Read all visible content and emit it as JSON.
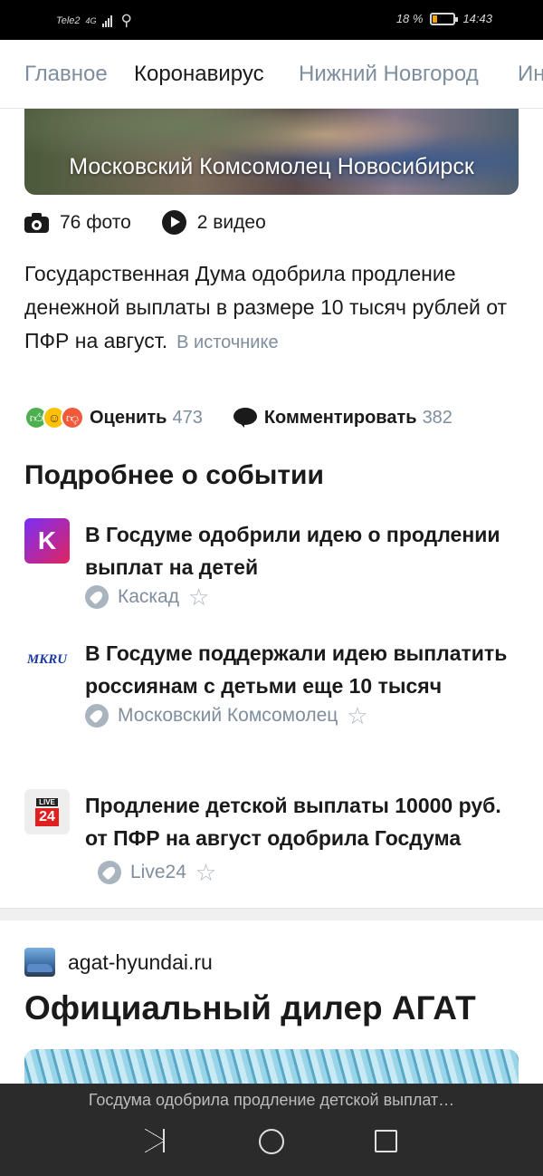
{
  "status_bar": {
    "carrier": "Tele2",
    "network": "4G",
    "battery_percent": "18 %",
    "battery_level": 0.18,
    "time": "14:43"
  },
  "tabs": [
    {
      "label": "Главное",
      "active": false
    },
    {
      "label": "Коронавирус",
      "active": true
    },
    {
      "label": "Нижний Новгород",
      "active": false
    },
    {
      "label": "Ин",
      "active": false
    }
  ],
  "hero": {
    "source": "Московский Комсомолец Новосибирск"
  },
  "media": {
    "photos": "76 фото",
    "videos": "2 видео"
  },
  "description": {
    "text": "Государственная Дума одобрила продление денежной выплаты в размере 10 тысяч рублей от ПФР на август.",
    "source_link": "В источнике"
  },
  "actions": {
    "rate_label": "Оценить",
    "rate_count": "473",
    "comment_label": "Комментировать",
    "comment_count": "382"
  },
  "more": {
    "title": "Подробнее о событии",
    "items": [
      {
        "title": "В Госдуме одобрили идею о продлении выплат на детей",
        "source": "Каскад",
        "logo": "K"
      },
      {
        "title": "В Госдуме поддержали идею выплатить россиянам с детьми еще 10 тысяч",
        "source": "Московский Комсомолец",
        "logo": "MKRU"
      },
      {
        "title": "Продление детской выплаты 10000 руб. от ПФР на август одобрила Госдума",
        "source": "Live24",
        "logo_top": "LIVE",
        "logo_num": "24"
      }
    ]
  },
  "ad": {
    "domain": "agat-hyundai.ru",
    "title": "Официальный дилер АГАТ"
  },
  "bottom": {
    "text": "Госдума одобрила продление детской выплат…"
  }
}
